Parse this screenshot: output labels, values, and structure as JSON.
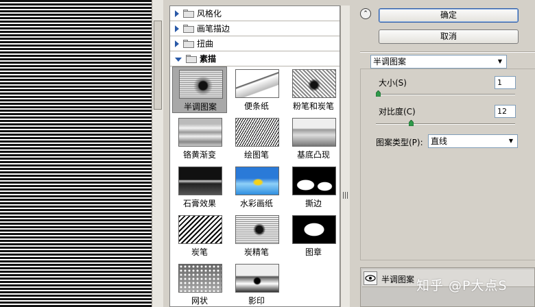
{
  "categories": [
    {
      "label": "风格化",
      "open": false
    },
    {
      "label": "画笔描边",
      "open": false
    },
    {
      "label": "扭曲",
      "open": false
    },
    {
      "label": "素描",
      "open": true
    }
  ],
  "thumbnails": [
    {
      "label": "半调图案",
      "selected": true
    },
    {
      "label": "便条纸",
      "selected": false
    },
    {
      "label": "粉笔和炭笔",
      "selected": false
    },
    {
      "label": "铬黄渐变",
      "selected": false
    },
    {
      "label": "绘图笔",
      "selected": false
    },
    {
      "label": "基底凸现",
      "selected": false
    },
    {
      "label": "石膏效果",
      "selected": false
    },
    {
      "label": "水彩画纸",
      "selected": false
    },
    {
      "label": "撕边",
      "selected": false
    },
    {
      "label": "炭笔",
      "selected": false
    },
    {
      "label": "炭精笔",
      "selected": false
    },
    {
      "label": "图章",
      "selected": false
    },
    {
      "label": "网状",
      "selected": false
    },
    {
      "label": "影印",
      "selected": false
    }
  ],
  "buttons": {
    "ok": "确定",
    "cancel": "取消"
  },
  "collapse_icon": "double-chevron-up-icon",
  "filter_select": {
    "value": "半调图案"
  },
  "options": {
    "size": {
      "label": "大小(S)",
      "value": "1",
      "fraction": 0.0
    },
    "contrast": {
      "label": "对比度(C)",
      "value": "12",
      "fraction": 0.24
    },
    "pattern_type": {
      "label": "图案类型(P):",
      "value": "直线"
    }
  },
  "layer": {
    "name": "半调图案"
  },
  "watermark": "知乎 @P大点S"
}
